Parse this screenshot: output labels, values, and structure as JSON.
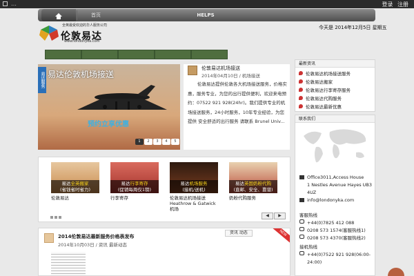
{
  "topbar": {
    "menu_dots": "…",
    "actions": "登录 注册"
  },
  "nav": {
    "items": [
      "首页",
      "",
      "",
      "",
      "HELPS",
      "",
      "",
      ""
    ]
  },
  "logo": {
    "cn": "伦敦易达",
    "tagline": "全英最受欢迎的华人服务公司",
    "url": "www.londonyka.com"
  },
  "date_text": "今天是 2014年12月5日 星期五",
  "subnav": [
    "",
    "",
    "",
    "",
    ""
  ],
  "slider": {
    "side_tag": "易达服务",
    "title": "易达伦敦机场接送",
    "subtitle": "预约立享优惠",
    "pages": [
      "1",
      "2",
      "3",
      "4",
      "5"
    ],
    "active": 1
  },
  "featured": {
    "title": "伦敦易达机场接送",
    "meta": "2014年04月10日 / 机场接送",
    "text": "伦敦易达提供伦敦各大机场接送服务，价格实惠，服务专业，为您的出行提供便利，欢迎来电预约：07522 921 928(24hr)。我们提供专业的机场接送服务，24小时服务，10年专业经验，为您提供 安全舒适的出行服务 请联系 Brunel Univ..."
  },
  "side_news": {
    "title": "最新资讯",
    "items": [
      "伦敦易达机场接送服务",
      "伦敦易达搬家",
      "伦敦易达行李寄存服务",
      "伦敦易达代购服务",
      "伦敦易达最新优惠"
    ]
  },
  "contact": {
    "title": "联系我们",
    "address_1": "Office3011,Access House",
    "address_2": "1 Nestles Avenue Hayes UB3 4UZ",
    "email": "info@londonyka.com",
    "phone_label_1": "客服热线",
    "phone_1": "+44(0)7825 412 088",
    "phone_2": "0208 573 1574(客服热线1)",
    "phone_3": "0208 573 4370(客服热线2)",
    "phone_label_2": "接机热线",
    "phone_4": "+44(0)7522 921 928(06:00-24:00)"
  },
  "services": [
    {
      "cap_1": "易达",
      "cap_hl": "全英搬家",
      "cap_2": "(省钱省时省力)",
      "title": "伦敦易达",
      "color": "#c98a4c"
    },
    {
      "cap_1": "易达",
      "cap_hl": "行李寄存",
      "cap_2": "(促销每周仅1镑)",
      "title": "行李寄存",
      "color": "#a3322c"
    },
    {
      "cap_1": "易达",
      "cap_hl": "机场服务",
      "cap_2": "(接机/送机)",
      "title": "伦敦易达机场接送Heathrow & Gatwick机场",
      "color": "#7a3d1f"
    },
    {
      "cap_1": "易达",
      "cap_hl": "英国奶粉代购",
      "cap_2": "(直邮、安全、靠谱)",
      "title": "奶粉代购服务",
      "color": "#b94a3a"
    }
  ],
  "post": {
    "title": "2014伦敦易达最新服务价格表发布",
    "meta": "2014年10月03日 / 资讯  最新动态",
    "category": "资讯  动态",
    "ribbon": "NEW"
  }
}
